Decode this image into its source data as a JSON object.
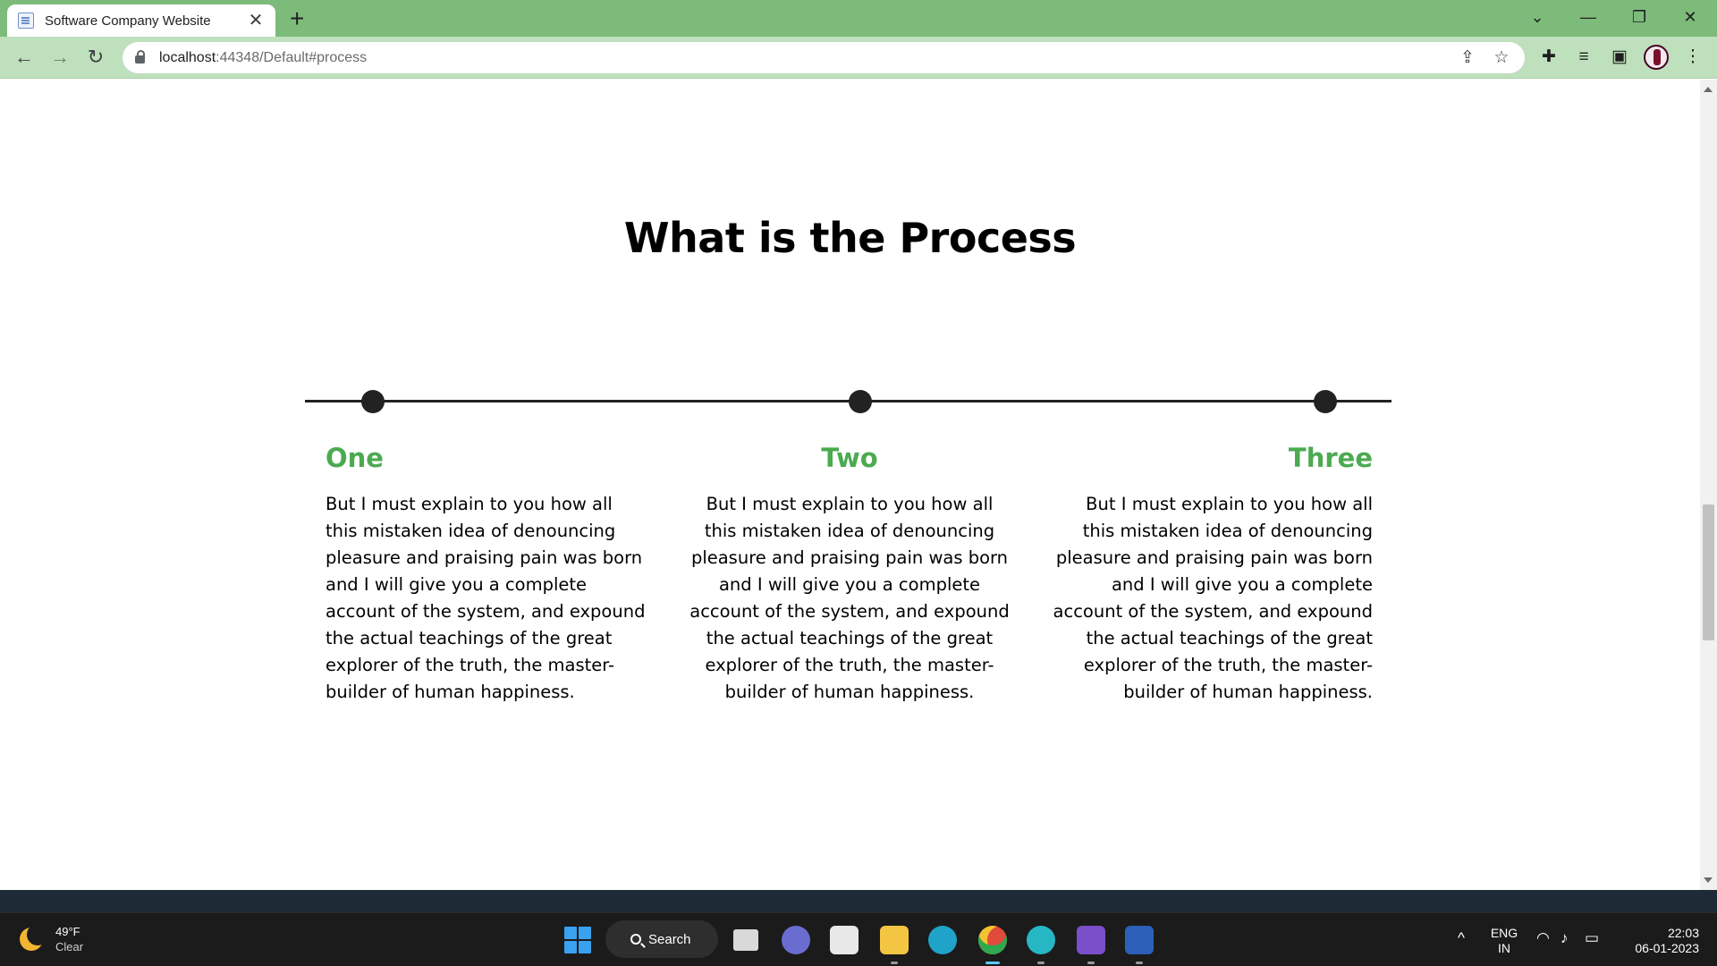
{
  "browser": {
    "tab_title": "Software Company Website",
    "tab_close": "✕",
    "new_tab": "+",
    "url_host": "localhost",
    "url_path": ":44348/Default#process",
    "window_controls": {
      "chevron": "⌄",
      "minimize": "—",
      "restore": "❐",
      "close": "✕"
    },
    "nav": {
      "back": "←",
      "forward": "→",
      "reload": "↻"
    },
    "icons": [
      "share-icon",
      "star-icon",
      "extensions-icon",
      "media-control-icon",
      "side-panel-icon",
      "profile-avatar",
      "menu-icon"
    ]
  },
  "page": {
    "heading": "What is the Process",
    "accent_color": "#4caa50",
    "steps": [
      {
        "label": "One",
        "text": "But I must explain to you how all this mistaken idea of denouncing pleasure and praising pain was born and I will give you a complete account of the system, and expound the actual teachings of the great explorer of the truth, the master-builder of human happiness."
      },
      {
        "label": "Two",
        "text": "But I must explain to you how all this mistaken idea of denouncing pleasure and praising pain was born and I will give you a complete account of the system, and expound the actual teachings of the great explorer of the truth, the master-builder of human happiness."
      },
      {
        "label": "Three",
        "text": "But I must explain to you how all this mistaken idea of denouncing pleasure and praising pain was born and I will give you a complete account of the system, and expound the actual teachings of the great explorer of the truth, the master-builder of human happiness."
      }
    ]
  },
  "taskbar": {
    "weather_temp": "49°F",
    "weather_condition": "Clear",
    "search_label": "Search",
    "language": "ENG",
    "region": "IN",
    "time": "22:03",
    "date": "06-01-2023",
    "tray_chevron": "^"
  }
}
